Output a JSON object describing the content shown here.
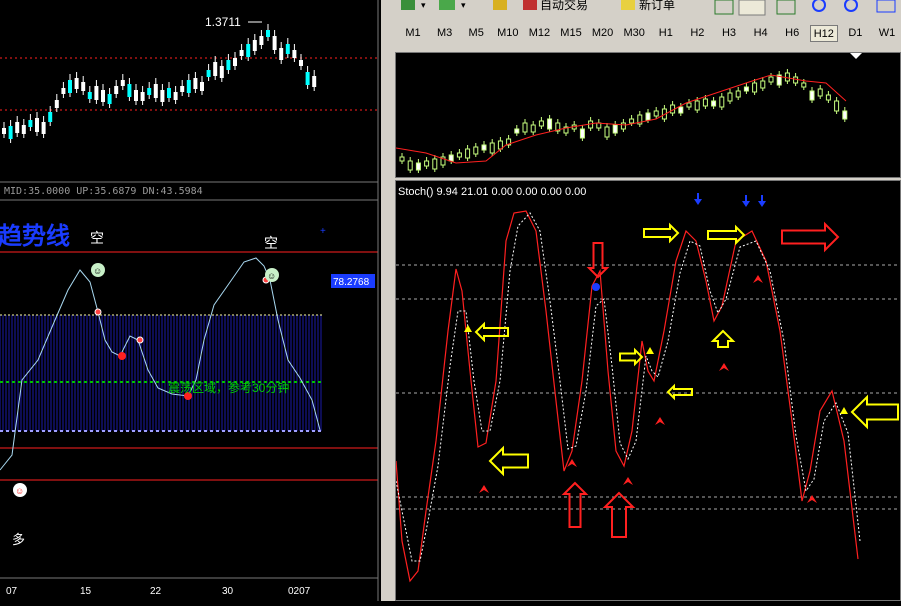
{
  "left_chart": {
    "price_label": "1.3711",
    "indicator_readout": "MID:35.0000  UP:35.6879  DN:43.5984",
    "trend_title": "趋势线",
    "short_label_1": "空",
    "short_label_2": "空",
    "long_label": "多",
    "value_badge": "78.2768",
    "range_note": "震荡区域，参考30分钟",
    "x_ticks": [
      "07",
      "15",
      "22",
      "30",
      "0207"
    ]
  },
  "toolbar": {
    "auto_trade_label": "自动交易",
    "new_order_label": "新订单",
    "timeframes": [
      "M1",
      "M3",
      "M5",
      "M10",
      "M12",
      "M15",
      "M20",
      "M30",
      "H1",
      "H2",
      "H3",
      "H4",
      "H6",
      "H12",
      "D1",
      "W1"
    ],
    "active_timeframe": "H12"
  },
  "stoch_panel": {
    "header": "Stoch() 9.94 21.01 0.00 0.00 0.00 0.00"
  },
  "colors": {
    "bull_candle": "#ffffff",
    "bear_candle": "#00ffff",
    "ma_line": "#ff2020",
    "stoch_main": "#ff2020",
    "stoch_signal": "#ffffff",
    "arrow_yellow": "#ffff00",
    "arrow_red": "#ff2020",
    "arrow_blue": "#1a3cff",
    "band_blue": "#1a1aa8"
  }
}
